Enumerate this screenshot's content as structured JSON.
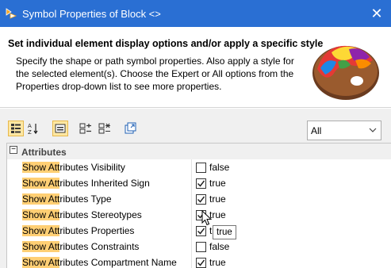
{
  "window": {
    "title": "Symbol Properties of Block <>",
    "close_icon": "close-icon"
  },
  "header": {
    "title": "Set individual element display options and/or apply a specific style",
    "description": "Specify the shape or path symbol properties. Also apply a style for the selected element(s). Choose the Expert or All options from the Properties drop-down list to see more properties.",
    "image": "palette-icon"
  },
  "toolbar": {
    "buttons": [
      {
        "icon": "categorized-view-icon",
        "active": true
      },
      {
        "icon": "sort-alphabetical-icon",
        "active": false
      },
      {
        "icon": "filter-icon",
        "active": true
      },
      {
        "icon": "expand-all-icon",
        "active": false
      },
      {
        "icon": "collapse-all-icon",
        "active": false
      },
      {
        "icon": "open-in-new-window-icon",
        "active": false
      }
    ],
    "mode_select": {
      "value": "All"
    }
  },
  "properties": {
    "section": "Attributes",
    "highlight": "Show Att",
    "rows": [
      {
        "name_rest": "ributes Visibility",
        "checked": false,
        "value": "false"
      },
      {
        "name_rest": "ributes Inherited Sign",
        "checked": true,
        "value": "true"
      },
      {
        "name_rest": "ributes Type",
        "checked": true,
        "value": "true"
      },
      {
        "name_rest": "ributes Stereotypes",
        "checked": true,
        "value": "true"
      },
      {
        "name_rest": "ributes Properties",
        "checked": true,
        "value": "t"
      },
      {
        "name_rest": "ributes Constraints",
        "checked": false,
        "value": "false"
      },
      {
        "name_rest": "ributes Compartment Name",
        "checked": true,
        "value": "true"
      }
    ]
  },
  "tooltip": {
    "text": "true"
  },
  "colors": {
    "titlebar": "#2a6fd3",
    "highlight": "#ffcf74",
    "panel": "#f0f0f0"
  }
}
